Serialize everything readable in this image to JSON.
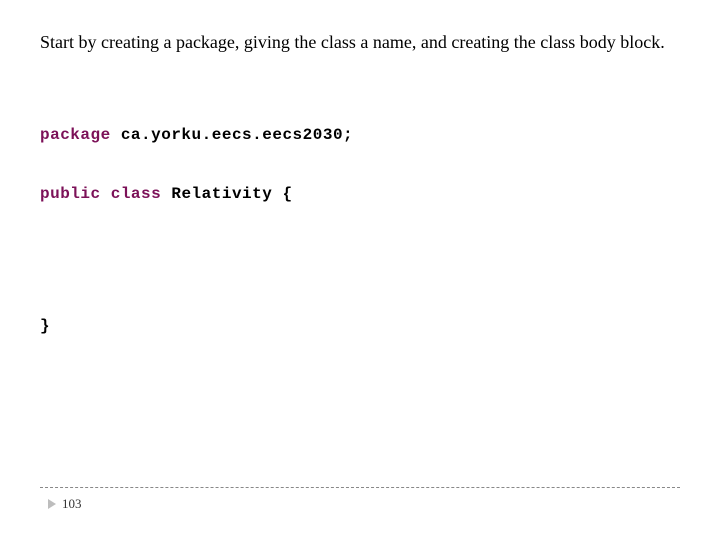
{
  "instruction": "Start by creating a package, giving the class a name, and creating the class body block.",
  "code": {
    "kw_package": "package",
    "package_name": " ca.yorku.eecs.eecs2030;",
    "kw_public": "public",
    "sp1": " ",
    "kw_class": "class",
    "class_decl": " Relativity {",
    "close": "}"
  },
  "page_number": "103"
}
